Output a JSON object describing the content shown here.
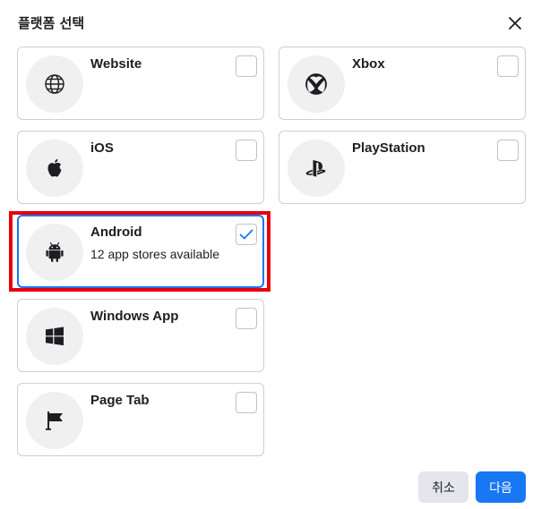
{
  "dialog": {
    "title": "플랫폼 선택",
    "close_icon": "close-icon"
  },
  "platforms": [
    {
      "label": "Website",
      "subtitle": "",
      "icon": "globe-icon",
      "checked": false
    },
    {
      "label": "Xbox",
      "subtitle": "",
      "icon": "xbox-icon",
      "checked": false
    },
    {
      "label": "iOS",
      "subtitle": "",
      "icon": "apple-icon",
      "checked": false
    },
    {
      "label": "PlayStation",
      "subtitle": "",
      "icon": "playstation-icon",
      "checked": false
    },
    {
      "label": "Android",
      "subtitle": "12 app stores available",
      "icon": "android-icon",
      "checked": true
    },
    {
      "label": "Windows App",
      "subtitle": "",
      "icon": "windows-icon",
      "checked": false
    },
    {
      "label": "Page Tab",
      "subtitle": "",
      "icon": "flag-icon",
      "checked": false
    }
  ],
  "footer": {
    "cancel_label": "취소",
    "next_label": "다음"
  },
  "colors": {
    "accent": "#1877f2",
    "highlight": "#e8000b",
    "border": "#ccd0d5",
    "icon_bg": "#f0f0f0"
  }
}
